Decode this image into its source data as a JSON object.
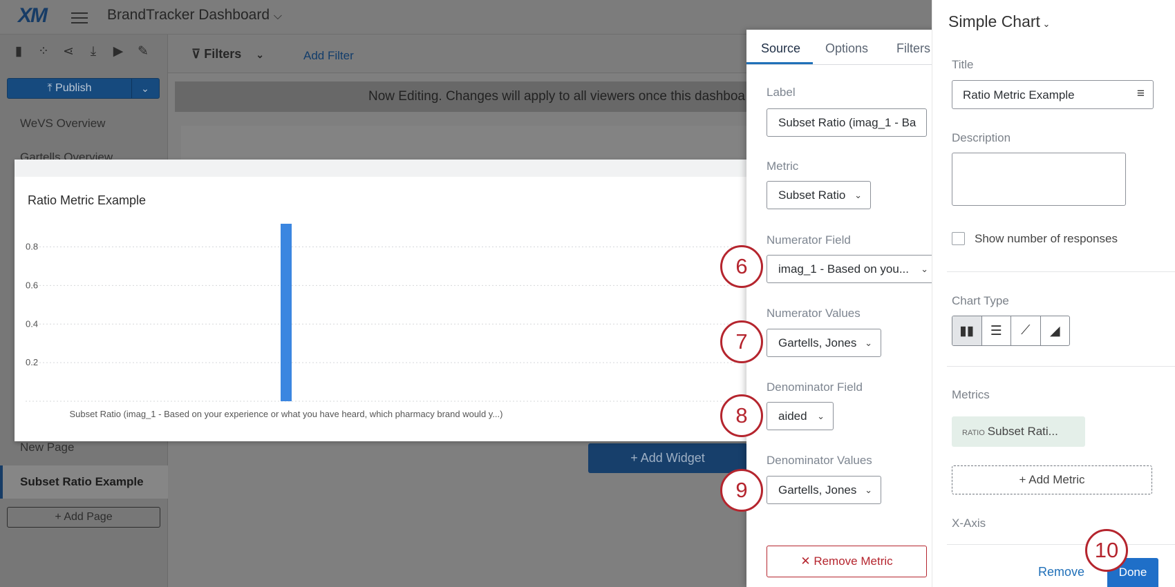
{
  "app": {
    "logo": "XM",
    "title": "BrandTracker Dashboard",
    "title_chevron": "⌵"
  },
  "toolbar_icons": [
    "bar-chart-icon",
    "scatter-icon",
    "share-icon",
    "download-icon",
    "play-icon",
    "paintbrush-icon"
  ],
  "publish": {
    "label": "⤒ Publish",
    "dropdown": "⌄"
  },
  "nav": {
    "pages": [
      "WeVS Overview",
      "Gartells Overview",
      "New Page"
    ],
    "active_page": "Subset Ratio Example",
    "add_page": "+ Add Page"
  },
  "filterbar": {
    "filters_label": "Filters",
    "add_filter": "Add Filter"
  },
  "banner": "Now Editing. Changes will apply to all viewers once this dashboa",
  "add_widget": "+ Add Widget",
  "chart_data": {
    "type": "bar",
    "title": "Ratio Metric Example",
    "categories": [
      "Subset Ratio (imag_1 - Based on your experience or what you have heard, which pharmacy brand would y...)"
    ],
    "values": [
      0.92
    ],
    "yticks": [
      "0.2",
      "0.4",
      "0.6",
      "0.8"
    ],
    "ylim": [
      0,
      0.92
    ],
    "grid": true,
    "bar_color": "#3b86e0"
  },
  "source_panel": {
    "tabs": [
      "Source",
      "Options",
      "Filters"
    ],
    "active_tab": "Source",
    "label_field": {
      "label": "Label",
      "value": "Subset Ratio (imag_1 - Ba"
    },
    "metric_field": {
      "label": "Metric",
      "value": "Subset Ratio"
    },
    "numerator_field": {
      "label": "Numerator Field",
      "value": "imag_1 - Based on you..."
    },
    "numerator_values": {
      "label": "Numerator Values",
      "value": "Gartells, Jones"
    },
    "denominator_field": {
      "label": "Denominator Field",
      "value": "aided"
    },
    "denominator_values": {
      "label": "Denominator Values",
      "value": "Gartells, Jones"
    },
    "remove_metric": "✕ Remove Metric"
  },
  "steps": [
    "6",
    "7",
    "8",
    "9",
    "10"
  ],
  "config_panel": {
    "widget_type": "Simple Chart",
    "title_label": "Title",
    "title_value": "Ratio Metric Example",
    "description_label": "Description",
    "show_responses": "Show number of responses",
    "chart_type_label": "Chart Type",
    "chart_types": [
      "bar-chart-icon",
      "horizontal-bar-icon",
      "line-chart-icon",
      "area-chart-icon"
    ],
    "metrics_label": "Metrics",
    "metric_tag": "RATIO",
    "metric_name": "Subset Rati...",
    "add_metric": "+ Add Metric",
    "xaxis_label": "X-Axis",
    "remove": "Remove",
    "done": "Done"
  },
  "colors": {
    "accent": "#1f6fc8",
    "step_red": "#b5252e",
    "bar": "#3b86e0"
  }
}
